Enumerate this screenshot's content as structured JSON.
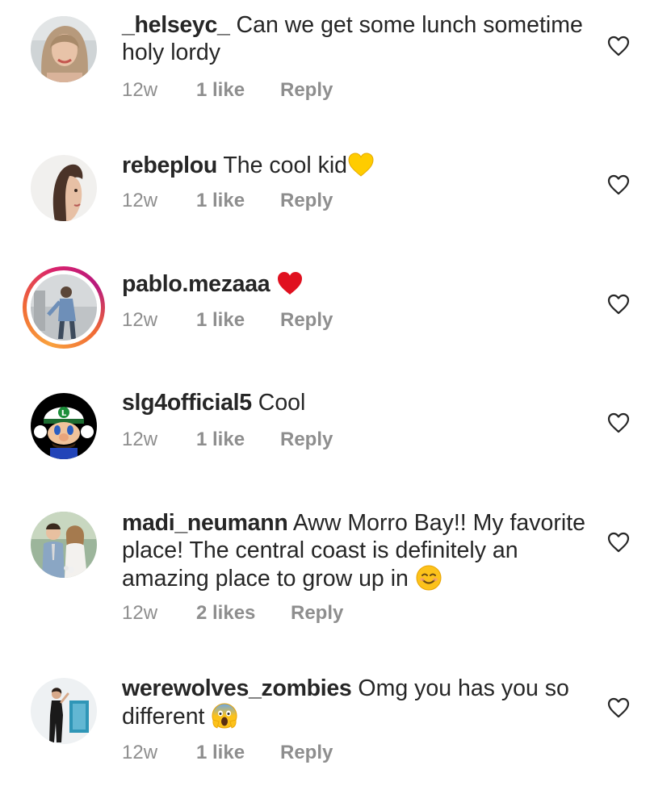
{
  "comments": [
    {
      "username": "_helseyc_",
      "text": "Can we get some lunch sometime holy lordy",
      "emoji": "",
      "time": "12w",
      "likes": "1 like",
      "reply": "Reply"
    },
    {
      "username": "rebeplou",
      "text": "The cool kid",
      "emoji": "yellow-heart",
      "time": "12w",
      "likes": "1 like",
      "reply": "Reply"
    },
    {
      "username": "pablo.mezaaa",
      "text": "",
      "emoji": "red-heart",
      "time": "12w",
      "likes": "1 like",
      "reply": "Reply"
    },
    {
      "username": "slg4official5",
      "text": "Cool",
      "emoji": "",
      "time": "12w",
      "likes": "1 like",
      "reply": "Reply"
    },
    {
      "username": "madi_neumann",
      "text": "Aww Morro Bay!! My favorite place! The central coast is definitely an amazing place to grow up in",
      "emoji": "smiling-face",
      "time": "12w",
      "likes": "2 likes",
      "reply": "Reply"
    },
    {
      "username": "werewolves_zombies",
      "text": "Omg you has you so different",
      "emoji": "screaming-face",
      "time": "12w",
      "likes": "1 like",
      "reply": "Reply"
    }
  ],
  "colors": {
    "text": "#262626",
    "meta": "#8e8e8e",
    "yellow_heart": "#ffcc00",
    "red_heart": "#e0101f",
    "story_ring_start": "#f9a13d",
    "story_ring_end": "#b8197d"
  }
}
